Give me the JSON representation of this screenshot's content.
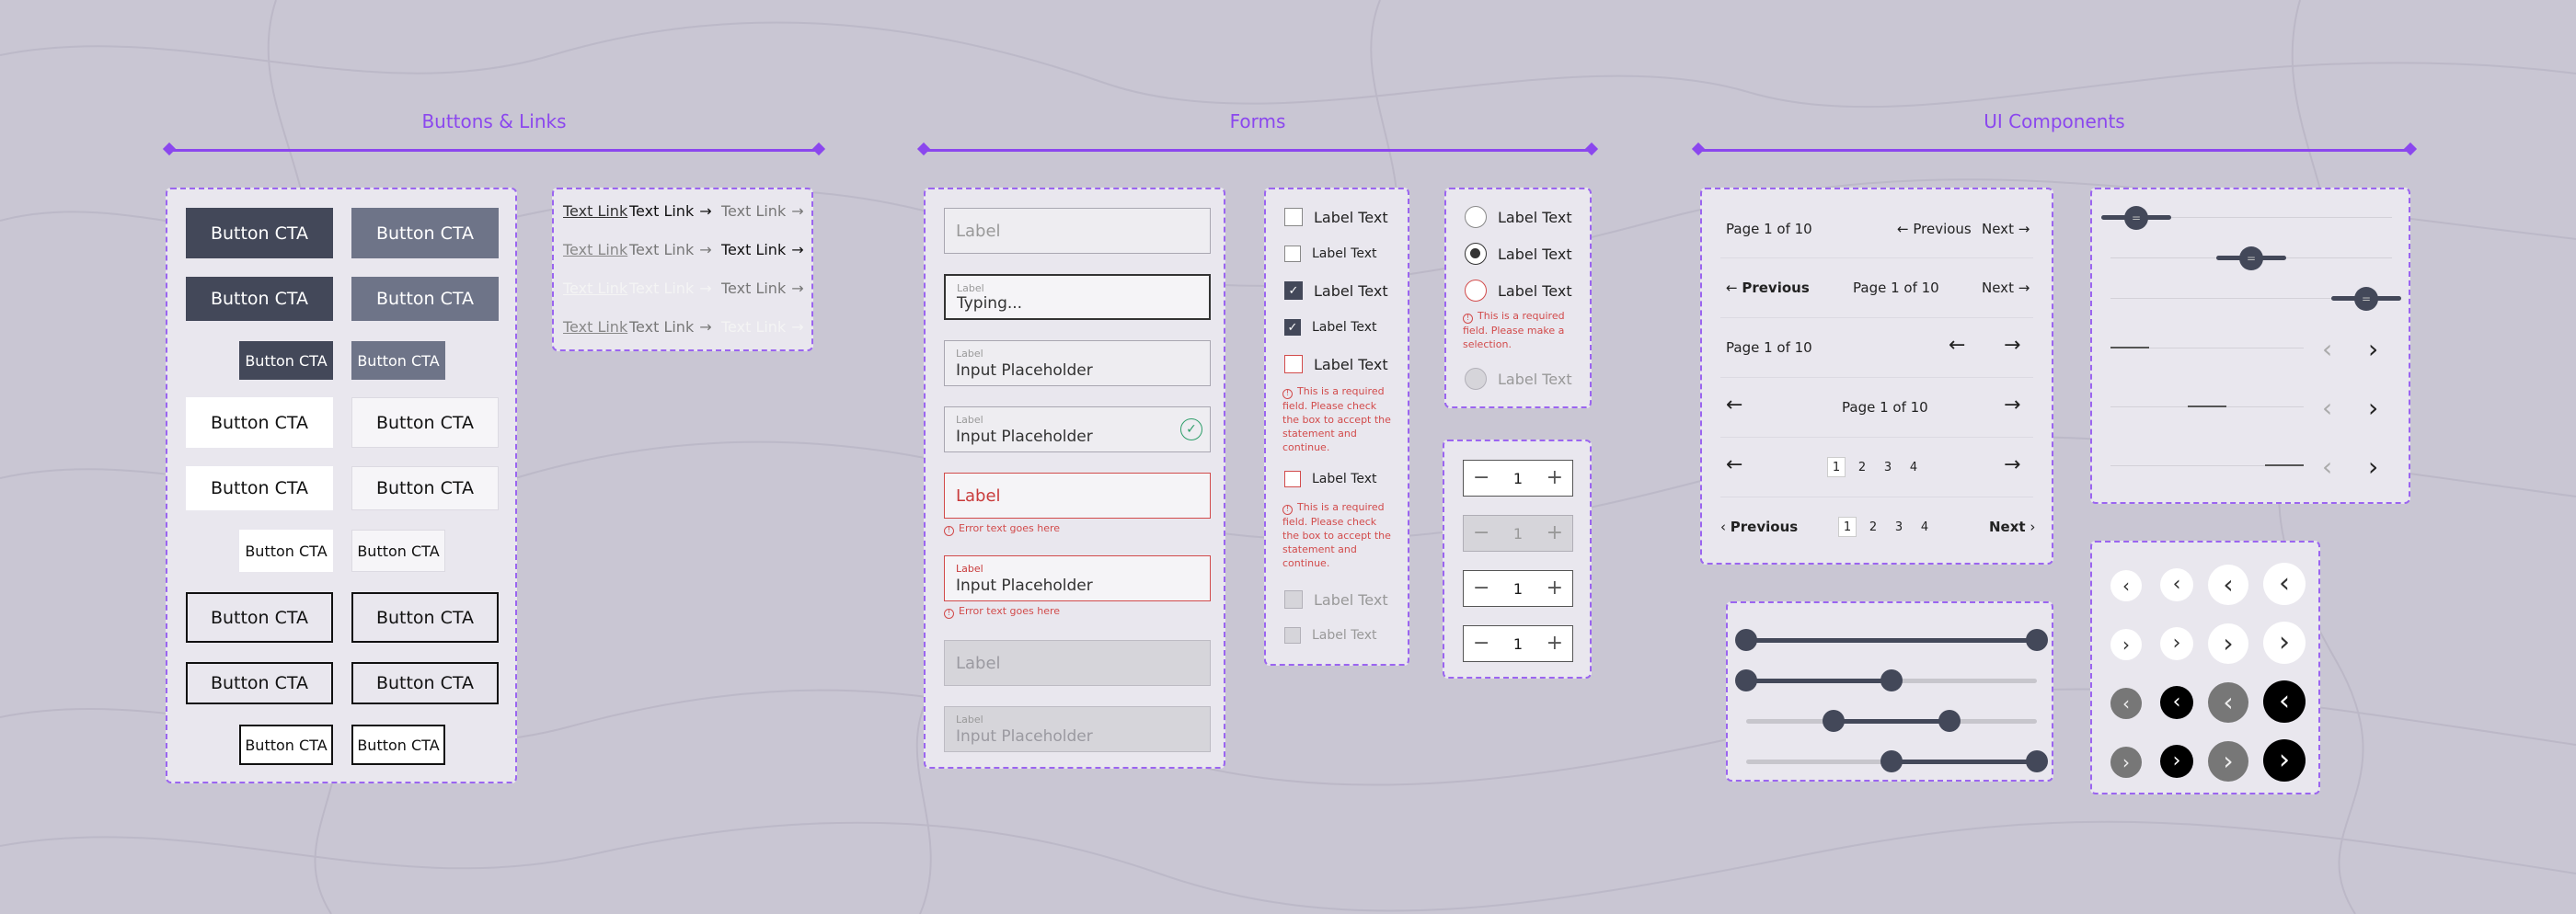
{
  "sections": {
    "buttons_links": "Buttons & Links",
    "forms": "Forms",
    "ui_components": "UI Components"
  },
  "buttons": {
    "cta": "Button CTA"
  },
  "links": {
    "text_link": "Text Link",
    "arrow": "→"
  },
  "inputs": {
    "label": "Label",
    "typing": "Typing...",
    "placeholder": "Input Placeholder",
    "error_text": "Error text goes here"
  },
  "checkboxes": {
    "label": "Label Text",
    "error": "This is a required field. Please check the box to accept the statement and continue."
  },
  "radios": {
    "label": "Label Text",
    "error": "This is a required field. Please make a selection."
  },
  "stepper": {
    "value": "1",
    "minus": "−",
    "plus": "+"
  },
  "pagination": {
    "page": "Page 1 of 10",
    "previous": "Previous",
    "next": "Next",
    "pages": [
      "1",
      "2",
      "3",
      "4"
    ]
  },
  "sliders": [
    {
      "min": 0,
      "max": 100,
      "low": 0,
      "high": 100
    },
    {
      "min": 0,
      "max": 100,
      "low": 0,
      "high": 50
    },
    {
      "min": 0,
      "max": 100,
      "low": 30,
      "high": 70
    },
    {
      "min": 0,
      "max": 100,
      "low": 50,
      "high": 100
    }
  ],
  "scroll_sliders": [
    {
      "position": 0.0
    },
    {
      "position": 0.5
    },
    {
      "position": 1.0
    }
  ],
  "icons": {
    "arrow_left": "←",
    "arrow_right": "→",
    "chevron_left": "‹",
    "chevron_right": "›",
    "check": "✓",
    "error": "!",
    "handle": "="
  },
  "colors": {
    "accent": "#8b47ee",
    "button_dark": "#434859",
    "button_slate": "#6e7488",
    "error": "#d24b4b",
    "success": "#2e9e6a",
    "background": "#c9c6d3"
  }
}
